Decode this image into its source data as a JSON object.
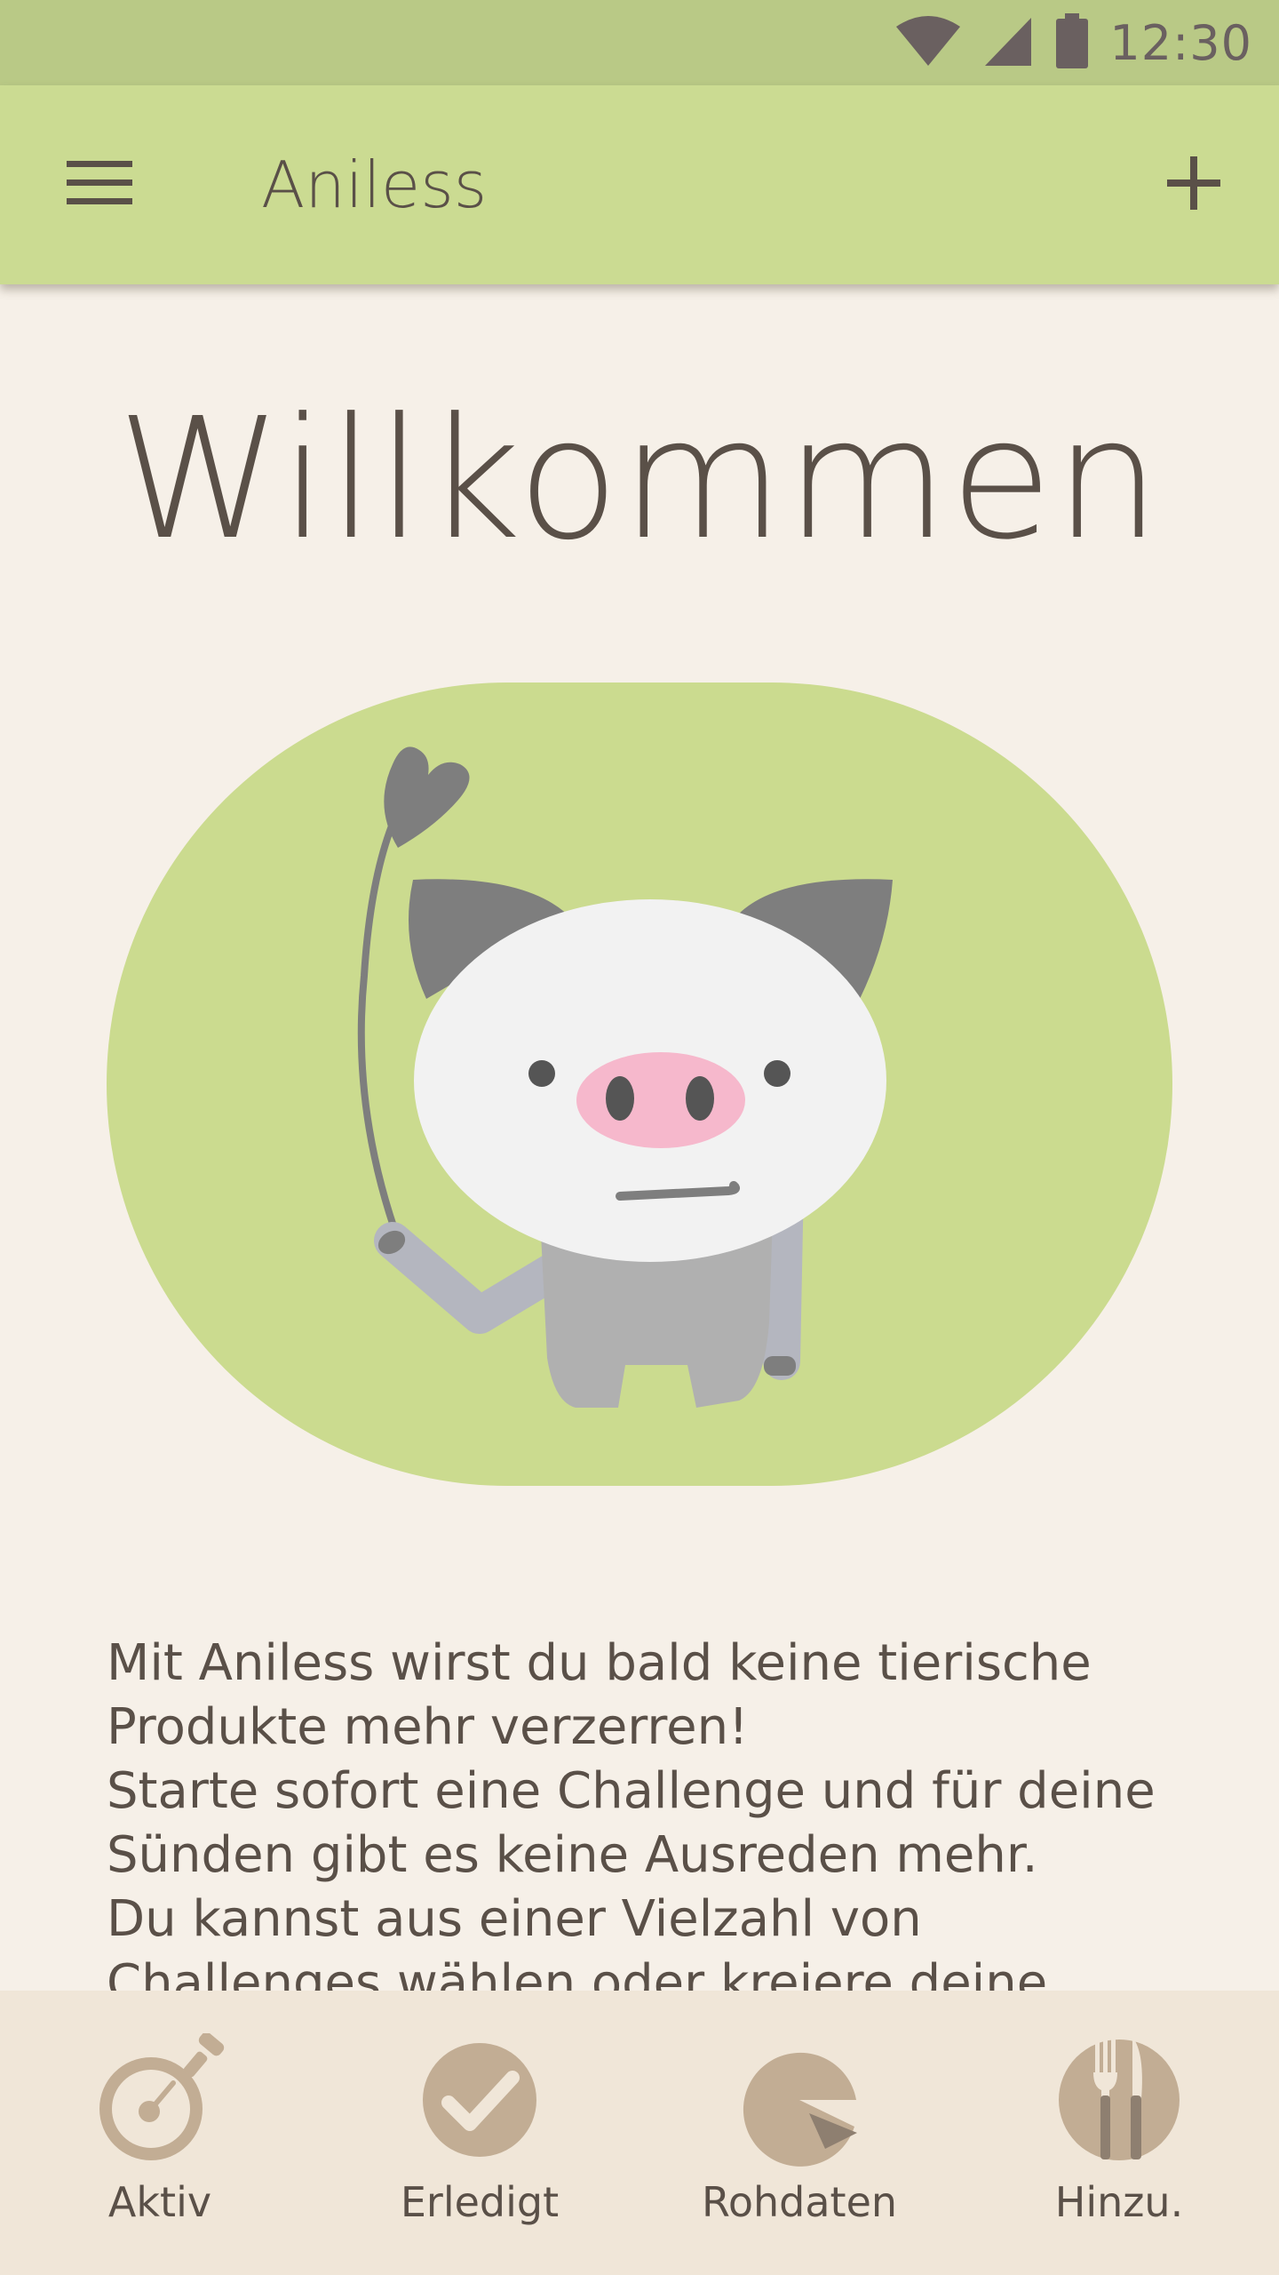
{
  "status_bar": {
    "time": "12:30",
    "icons": [
      "wifi-icon",
      "signal-icon",
      "battery-icon"
    ]
  },
  "app_bar": {
    "title": "Aniless",
    "menu_icon": "hamburger-menu-icon",
    "add_icon": "plus-icon"
  },
  "main": {
    "heading": "Willkommen",
    "illustration": "pig-with-heart-balloon",
    "intro_lines": [
      "Mit Aniless wirst du bald keine tierische",
      "Produkte mehr verzerren!",
      "Starte sofort eine Challenge und für deine",
      "Sünden gibt es keine Ausreden mehr.",
      "Du kannst aus einer Vielzahl von",
      "Challenges wählen oder kreiere deine"
    ]
  },
  "bottom_nav": {
    "items": [
      {
        "label": "Aktiv",
        "icon": "stopwatch-icon"
      },
      {
        "label": "Erledigt",
        "icon": "checkmark-icon"
      },
      {
        "label": "Rohdaten",
        "icon": "pie-chart-icon"
      },
      {
        "label": "Hinzu.",
        "icon": "fork-knife-icon"
      }
    ]
  },
  "colors": {
    "status_bar": "#b9c986",
    "app_bar": "#cbdb92",
    "background": "#f6f0e8",
    "bottom_nav": "#f0e6d8",
    "text": "#5a5048",
    "nav_icon": "#c2ad94",
    "hero_blob": "#cbdb8f"
  }
}
